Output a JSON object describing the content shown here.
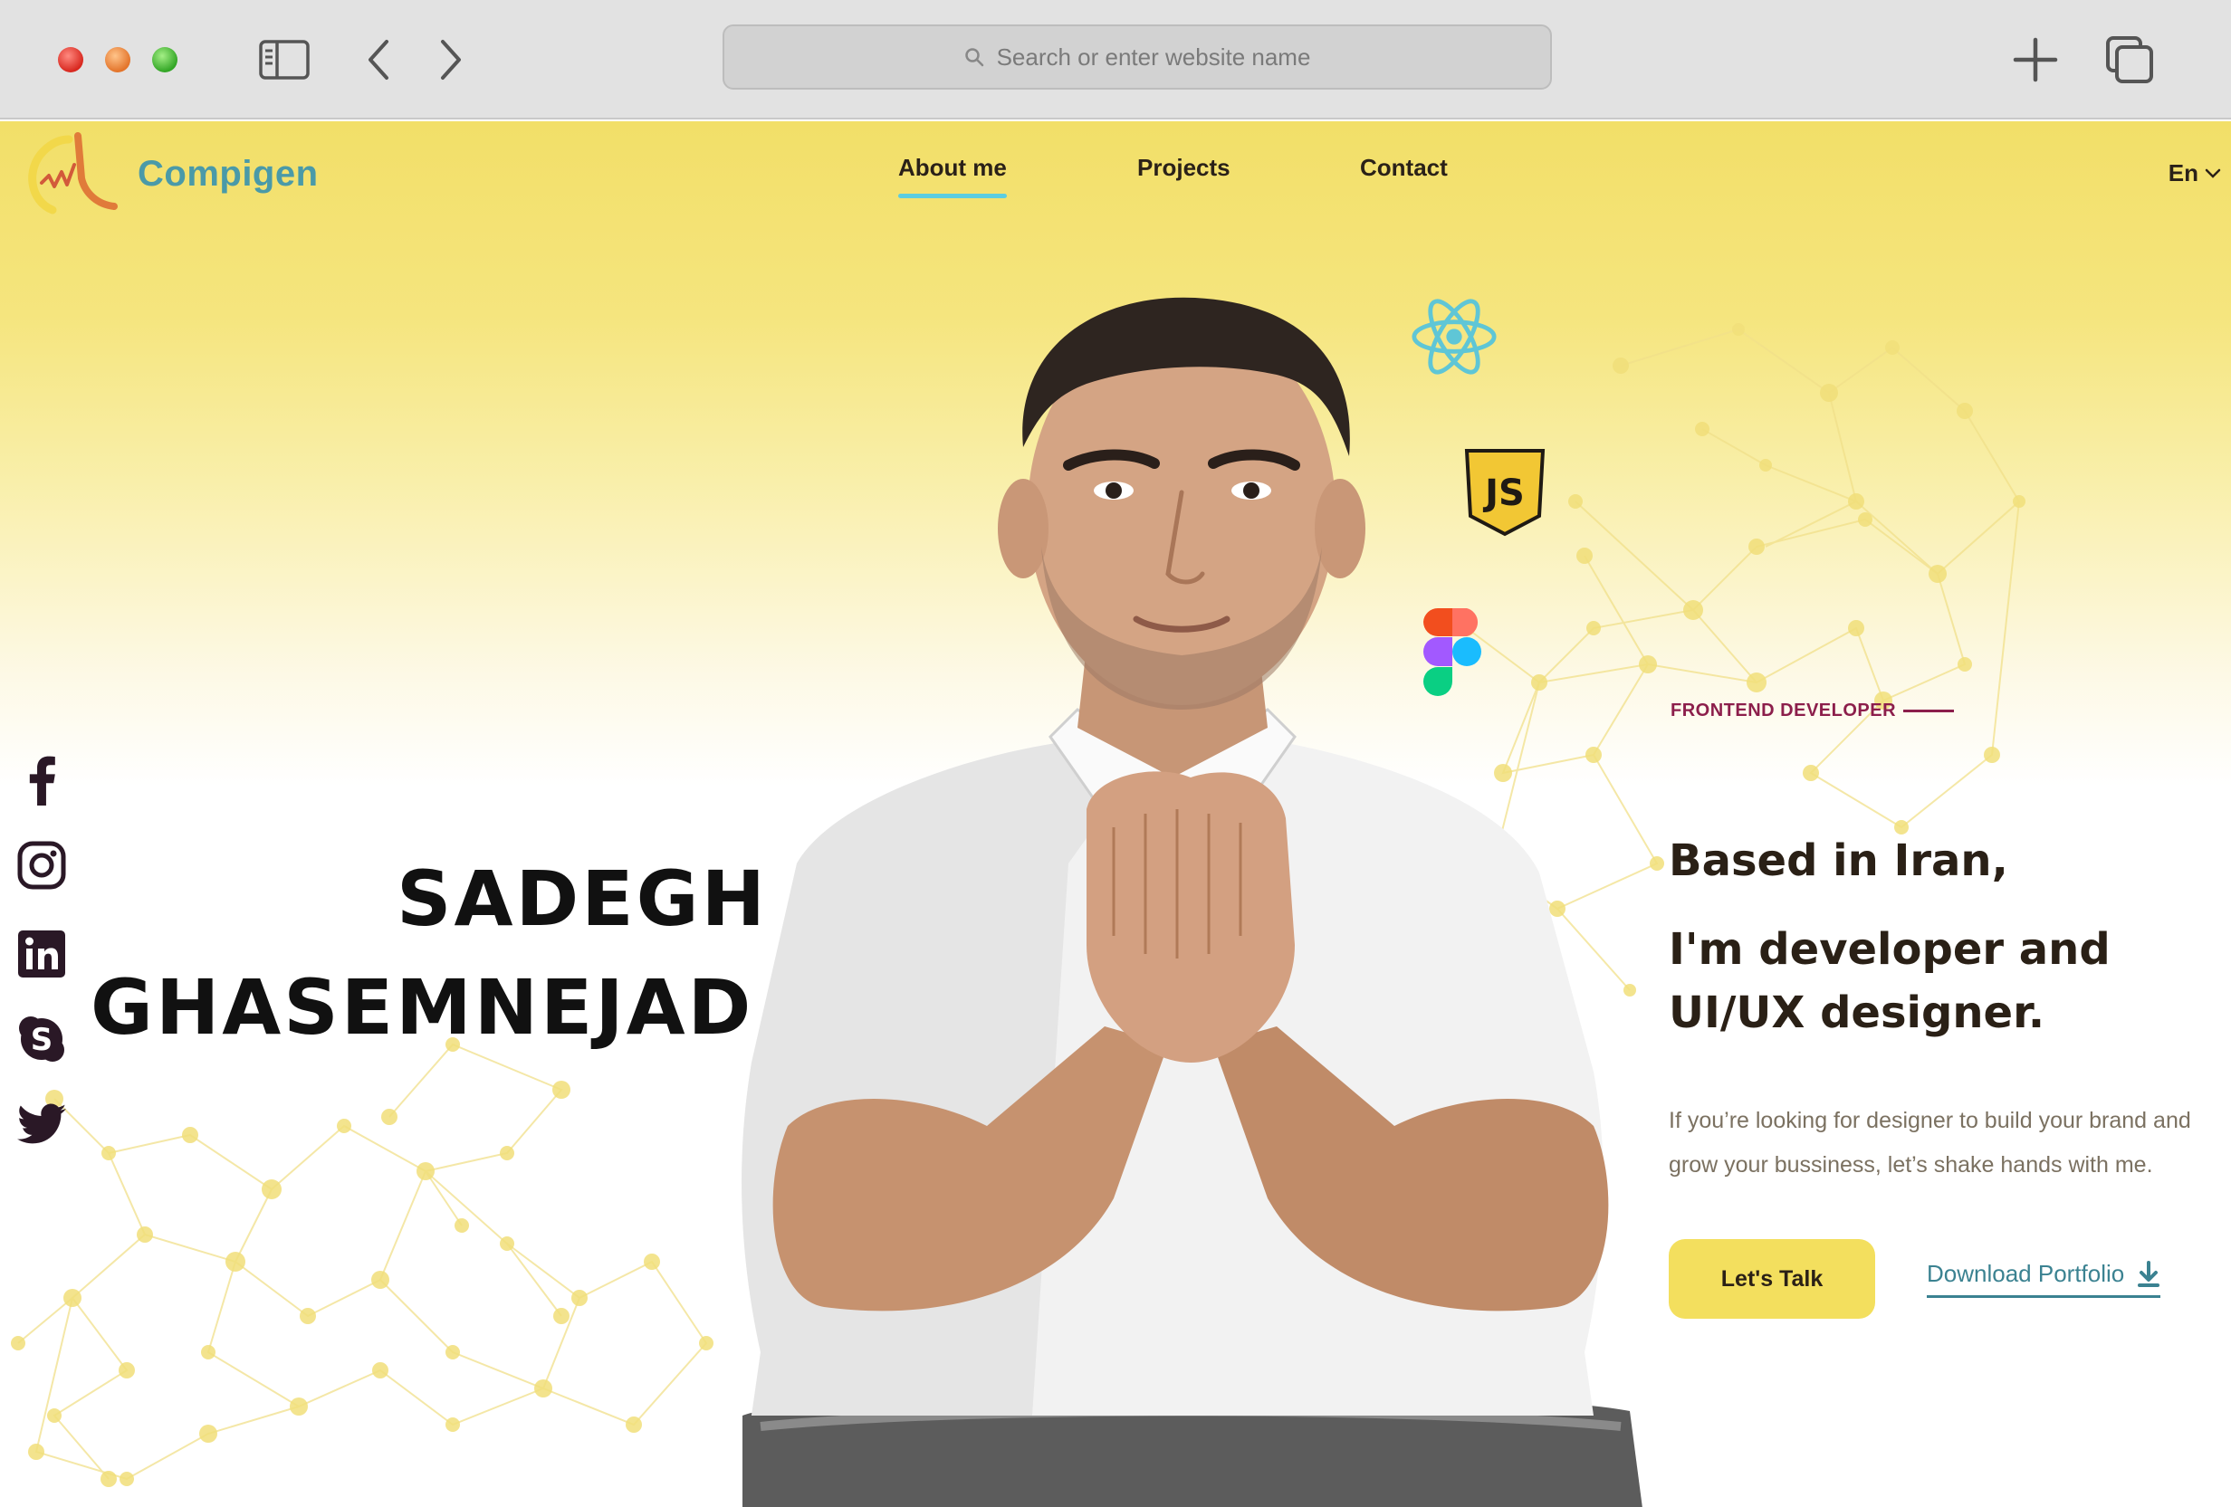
{
  "browser": {
    "url_placeholder": "Search or enter website name",
    "icons": [
      "sidebar-icon",
      "back-icon",
      "forward-icon",
      "new-tab-icon",
      "tabs-overview-icon"
    ]
  },
  "site": {
    "brand": "Compigen",
    "nav": [
      {
        "label": "About me",
        "active": true
      },
      {
        "label": "Projects",
        "active": false
      },
      {
        "label": "Contact",
        "active": false
      }
    ],
    "language": "En"
  },
  "socials": [
    "facebook-icon",
    "instagram-icon",
    "linkedin-icon",
    "skype-icon",
    "twitter-icon"
  ],
  "hero": {
    "first_name": "SADEGH",
    "last_name": "GHASEMNEJAD",
    "role": "FRONTEND DEVELOPER",
    "headline_1": "Based in Iran,",
    "headline_2": "I'm developer and",
    "headline_3": "UI/UX designer.",
    "description": "If you’re looking for designer to build your brand and grow your bussiness, let’s shake hands with me.",
    "cta_primary": "Let's Talk",
    "cta_secondary": "Download Portfolio",
    "tech_icons": [
      "react-icon",
      "javascript-icon",
      "figma-icon"
    ]
  },
  "colors": {
    "accent_yellow": "#f3df5e",
    "teal": "#3b8291",
    "role_color": "#8c1e4b",
    "nav_underline": "#5ccde0"
  }
}
